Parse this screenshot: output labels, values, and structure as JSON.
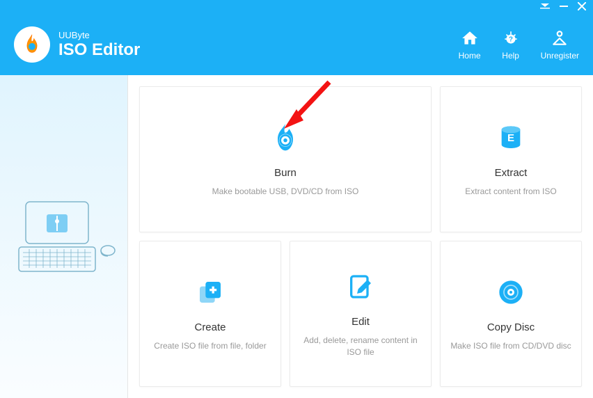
{
  "brand": "UUByte",
  "appTitle": "ISO Editor",
  "nav": {
    "home": "Home",
    "help": "Help",
    "unregister": "Unregister"
  },
  "tiles": {
    "burn": {
      "title": "Burn",
      "desc": "Make bootable USB, DVD/CD from ISO"
    },
    "extract": {
      "title": "Extract",
      "desc": "Extract content from ISO"
    },
    "create": {
      "title": "Create",
      "desc": "Create ISO file from file, folder"
    },
    "edit": {
      "title": "Edit",
      "desc": "Add, delete, rename content in ISO file"
    },
    "copy": {
      "title": "Copy Disc",
      "desc": "Make ISO file from CD/DVD disc"
    }
  }
}
